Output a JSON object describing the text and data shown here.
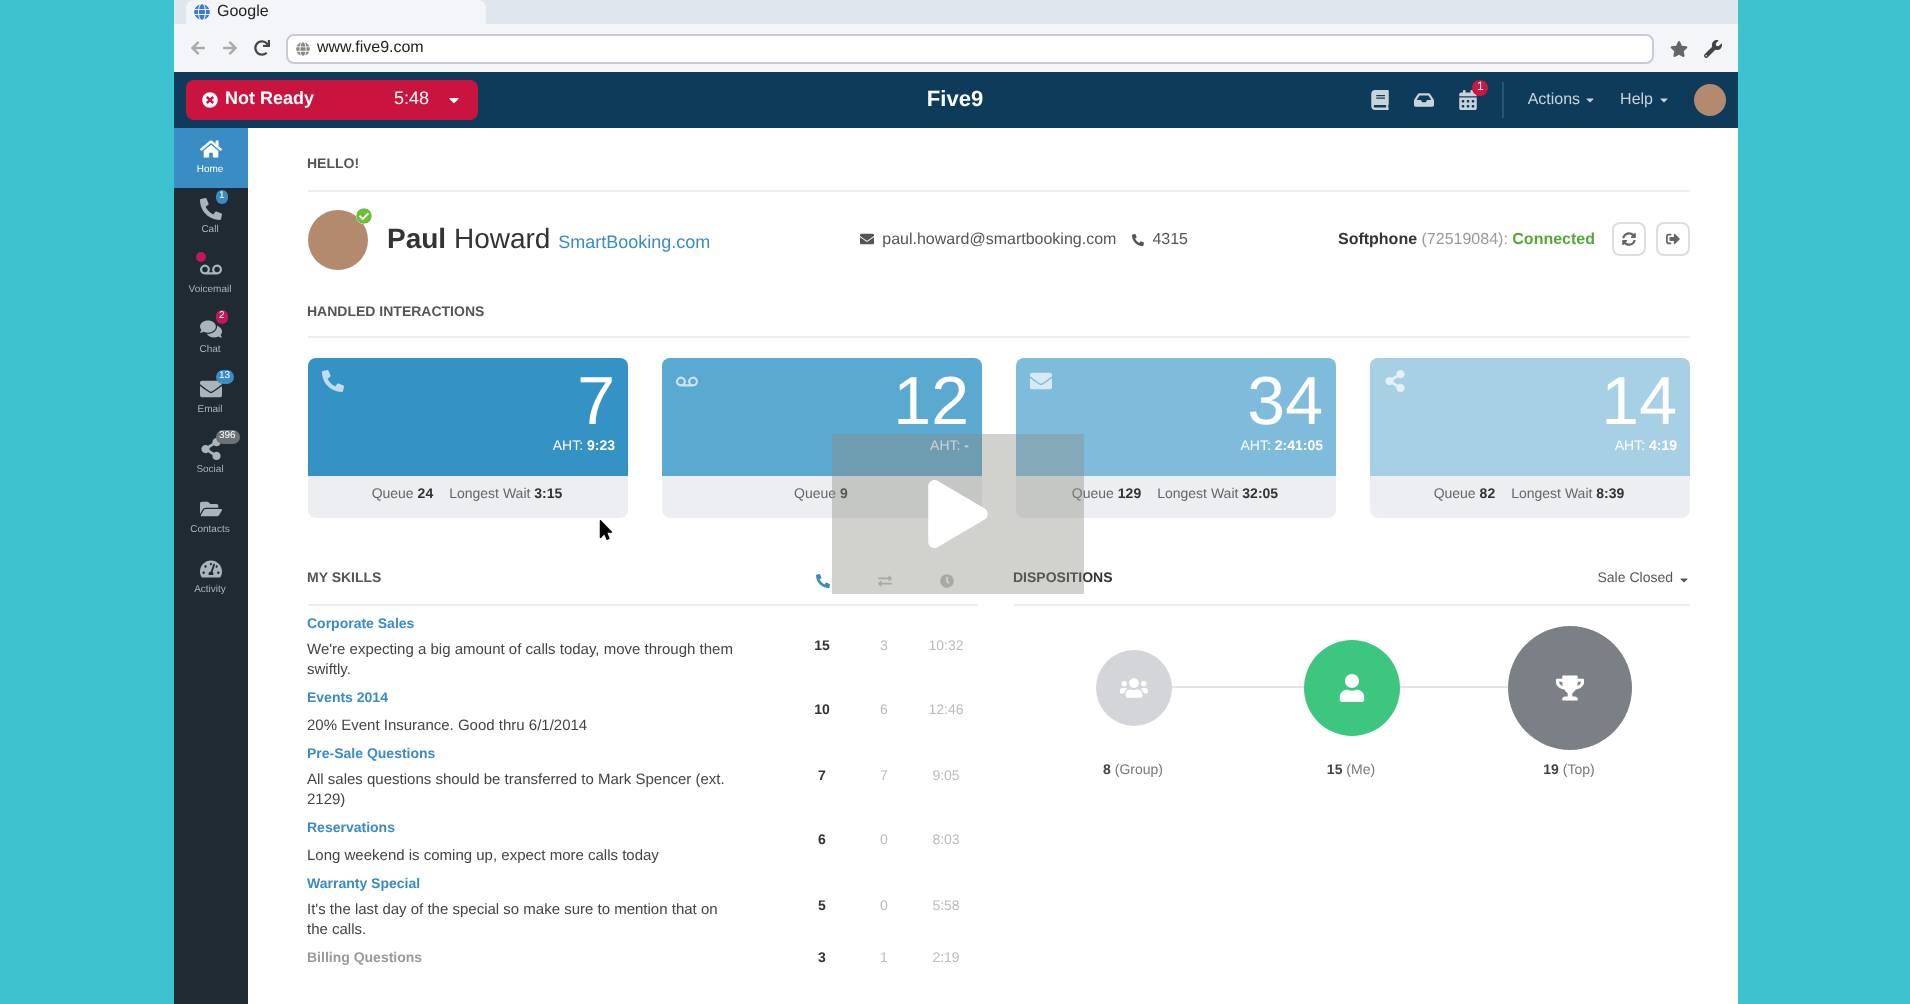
{
  "browser": {
    "tab_title": "Google",
    "url": "www.five9.com"
  },
  "header": {
    "status": {
      "label": "Not Ready",
      "timer": "5:48"
    },
    "logo": "Five9",
    "icons": [
      {
        "kind": "book"
      },
      {
        "kind": "inbox"
      },
      {
        "kind": "calendar",
        "badge": "1"
      }
    ],
    "menus": [
      "Actions",
      "Help"
    ]
  },
  "sidebar": {
    "items": [
      {
        "kind": "home",
        "label": "Home",
        "selected": true
      },
      {
        "kind": "call",
        "label": "Call",
        "selected": false,
        "badge": "1",
        "color": "#3a8cc4"
      },
      {
        "kind": "voicemail",
        "label": "Voicemail",
        "selected": false,
        "color": "#c2185b"
      },
      {
        "kind": "chat",
        "label": "Chat",
        "selected": false,
        "badge": "2",
        "color": "#c2185b"
      },
      {
        "kind": "email",
        "label": "Email",
        "selected": false,
        "badge": "13",
        "color": "#3a8cc4"
      },
      {
        "kind": "social",
        "label": "Social",
        "selected": false,
        "badge": "396",
        "color": "#6b7278"
      },
      {
        "kind": "contacts",
        "label": "Contacts",
        "selected": false
      },
      {
        "kind": "activity",
        "label": "Activity",
        "selected": false
      }
    ]
  },
  "greeting": "HELLO!",
  "user": {
    "first_name": "Paul",
    "last_name": "Howard",
    "company": "SmartBooking.com",
    "online": true,
    "email": "paul.howard@smartbooking.com",
    "extension": "4315",
    "softphone_label": "Softphone",
    "softphone_id": "(72519084):",
    "softphone_status": "Connected"
  },
  "interactions": {
    "title": "HANDLED INTERACTIONS",
    "cards": [
      {
        "kind": "call",
        "color": "#3592c4",
        "count": "7",
        "aht_label": "AHT:",
        "aht": "9:23",
        "queue_label": "Queue",
        "queue": "24",
        "wait_label": "Longest Wait",
        "wait": "3:15"
      },
      {
        "kind": "voicemail",
        "color": "#5aa9d0",
        "count": "12",
        "aht_label": "AHT:",
        "aht": "-",
        "queue_label": "Queue",
        "queue": "9"
      },
      {
        "kind": "email",
        "color": "#7fbcdc",
        "count": "34",
        "aht_label": "AHT:",
        "aht": "2:41:05",
        "queue_label": "Queue",
        "queue": "129",
        "wait_label": "Longest Wait",
        "wait": "32:05"
      },
      {
        "kind": "social",
        "color": "#a8d0e5",
        "count": "14",
        "aht_label": "AHT:",
        "aht": "4:19",
        "queue_label": "Queue",
        "queue": "82",
        "wait_label": "Longest Wait",
        "wait": "8:39"
      }
    ]
  },
  "skills": {
    "title": "MY SKILLS",
    "columns": [
      {
        "kind": "phone"
      },
      {
        "kind": "transfer"
      },
      {
        "kind": "clock"
      }
    ],
    "rows": [
      {
        "name": "Corporate Sales",
        "note": "We're expecting a big amount of calls today, move through them swiftly.",
        "column_1": "15",
        "column_2": "3",
        "column_3": "10:32",
        "disabled": false
      },
      {
        "name": "Events 2014",
        "note": "20% Event Insurance. Good thru 6/1/2014",
        "column_1": "10",
        "column_2": "6",
        "column_3": "12:46",
        "disabled": false
      },
      {
        "name": "Pre-Sale Questions",
        "note": "All sales questions should be transferred to Mark Spencer (ext. 2129)",
        "column_1": "7",
        "column_2": "7",
        "column_3": "9:05",
        "disabled": false
      },
      {
        "name": "Reservations",
        "note": "Long weekend is coming up, expect more calls today",
        "column_1": "6",
        "column_2": "0",
        "column_3": "8:03",
        "disabled": false
      },
      {
        "name": "Warranty Special",
        "note": "It's the last day of the special so make sure to mention that on the calls.",
        "column_1": "5",
        "column_2": "0",
        "column_3": "5:58",
        "disabled": false
      },
      {
        "name": "Billing Questions",
        "column_1": "3",
        "column_2": "1",
        "column_3": "2:19",
        "disabled": true
      }
    ]
  },
  "dispositions": {
    "title": "DISPOSITIONS",
    "filter": "Sale Closed",
    "items": [
      {
        "kind": "group",
        "color": "#d3d5d8",
        "value": "8",
        "label": "(Group)"
      },
      {
        "kind": "me",
        "color": "#3dc77e",
        "value": "15",
        "label": "(Me)"
      },
      {
        "kind": "top",
        "color": "#7b8087",
        "value": "19",
        "label": "(Top)"
      }
    ]
  }
}
